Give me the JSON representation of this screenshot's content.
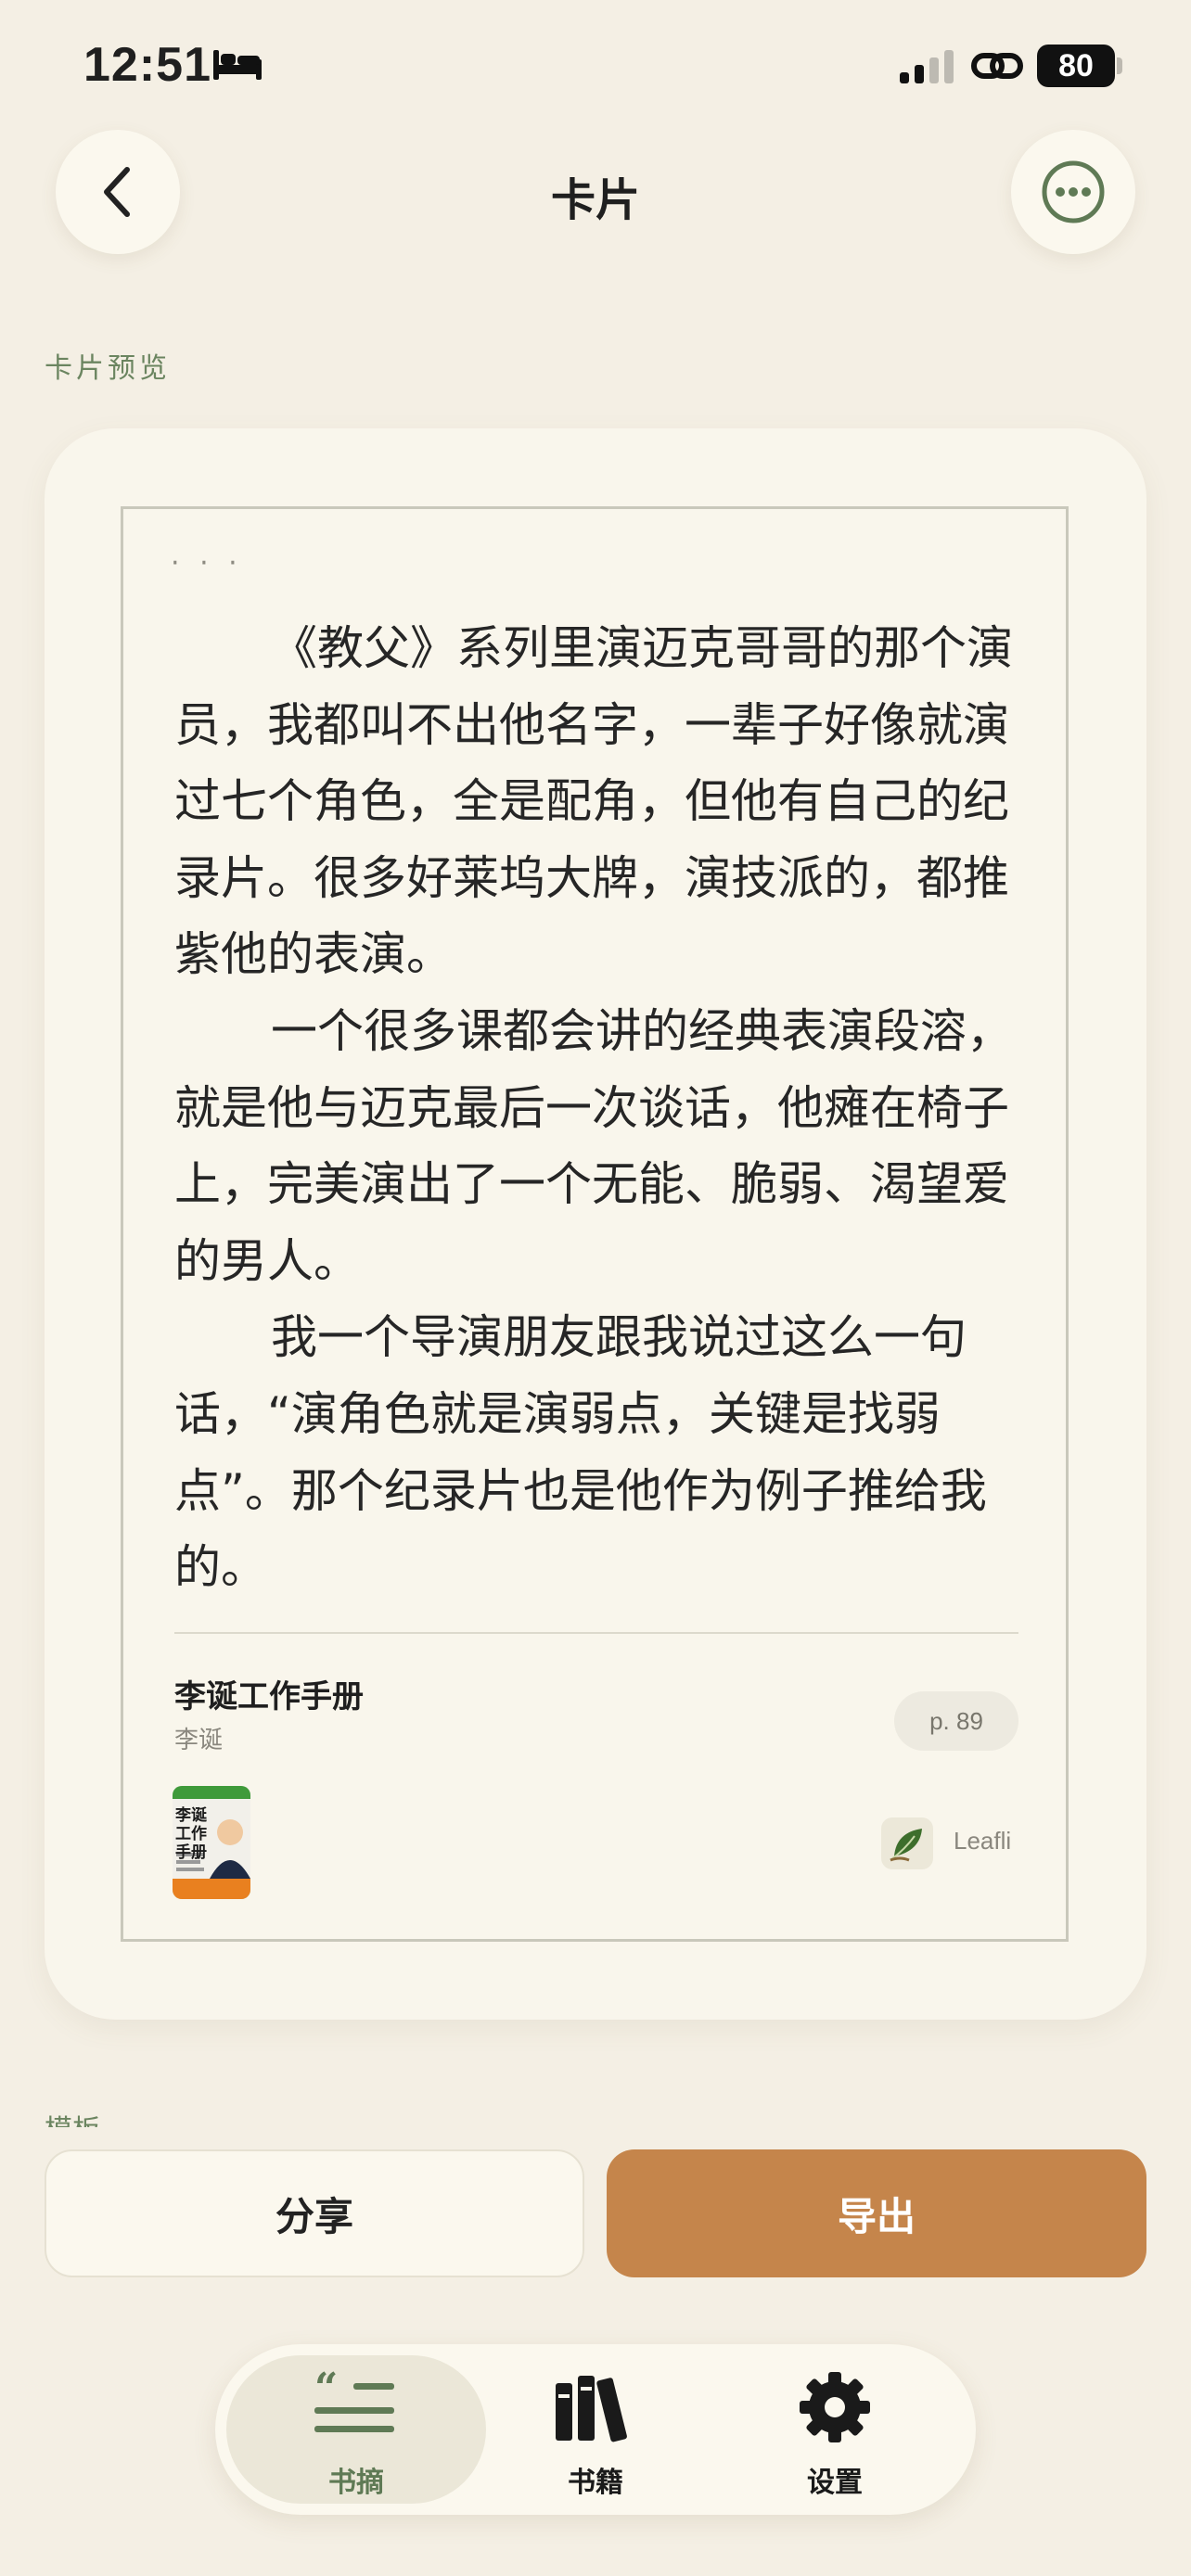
{
  "status_bar": {
    "time": "12:51",
    "battery": "80",
    "icons": [
      "bed-icon",
      "signal-icon",
      "link-icon",
      "battery-icon"
    ]
  },
  "nav": {
    "title": "卡片",
    "back_icon": "chevron-left-icon",
    "more_icon": "ellipsis-circle-icon"
  },
  "section_label": "卡片预览",
  "card": {
    "ellipsis": "· · ·",
    "paragraphs": [
      "《教父》系列里演迈克哥哥的那个演员，我都叫不出他名字，一辈子好像就演过七个角色，全是配角，但他有自己的纪录片。很多好莱坞大牌，演技派的，都推紫他的表演。",
      "一个很多课都会讲的经典表演段溶，就是他与迈克最后一次谈话，他瘫在椅子上，完美演出了一个无能、脆弱、渴望爱的男人。",
      "我一个导演朋友跟我说过这么一句话，“演角色就是演弱点，关键是找弱点”。那个纪录片也是他作为例子推给我的。"
    ],
    "book_title": "李诞工作手册",
    "author": "李诞",
    "page": "p. 89",
    "cover_text": "李诞 工作手册",
    "brand": "Leafli"
  },
  "template_label": "模板",
  "actions": {
    "share": "分享",
    "export": "导出"
  },
  "tabbar": {
    "tabs": [
      {
        "label": "书摘",
        "icon": "quote-icon",
        "active": true
      },
      {
        "label": "书籍",
        "icon": "books-icon",
        "active": false
      },
      {
        "label": "设置",
        "icon": "gear-icon",
        "active": false
      }
    ]
  },
  "colors": {
    "background": "#f4efe4",
    "card": "#f9f6ec",
    "accent_green": "#6b8560",
    "export_button": "#c5854b"
  }
}
